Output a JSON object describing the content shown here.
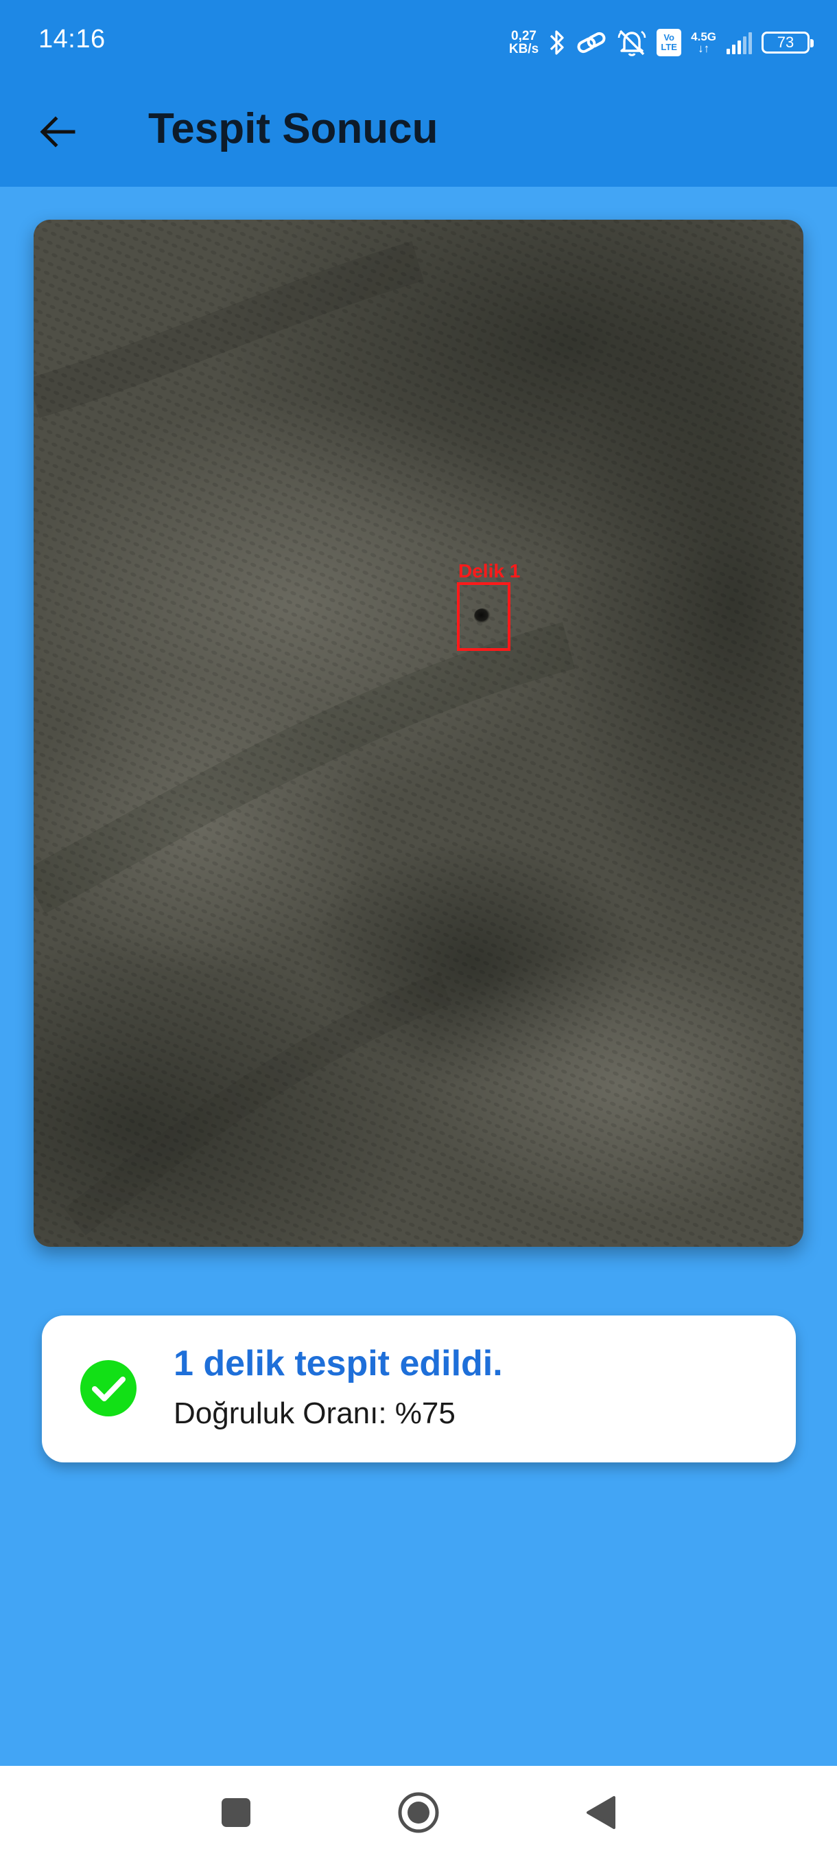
{
  "status_bar": {
    "time": "14:16",
    "net_speed_value": "0,27",
    "net_speed_unit": "KB/s",
    "volte_top": "Vo",
    "volte_bottom": "LTE",
    "net_type": "4.5G",
    "net_arrows": "↓↑",
    "battery_level": "73",
    "icons": [
      "bluetooth-icon",
      "link-icon",
      "muted-bell-icon",
      "volte-icon",
      "signal-icon",
      "battery-icon"
    ]
  },
  "app_bar": {
    "title": "Tespit Sonucu",
    "back_icon": "arrow-left-icon"
  },
  "photo": {
    "detection_label": "Delik 1",
    "detection_color": "#ff1a1a"
  },
  "result": {
    "title": "1 delik tespit edildi.",
    "subtitle": "Doğruluk Oranı: %75",
    "icon": "check-circle-icon",
    "icon_color": "#12e016",
    "title_color": "#1e6fd9"
  },
  "nav_bar": {
    "items": [
      "recents-icon",
      "home-icon",
      "back-icon"
    ]
  },
  "colors": {
    "app_bar": "#1e88e5",
    "background": "#42a5f5",
    "card": "#ffffff"
  }
}
